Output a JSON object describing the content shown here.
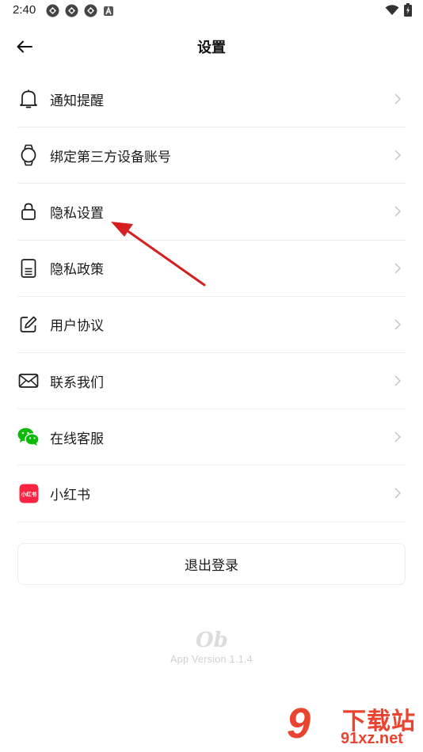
{
  "status_bar": {
    "time": "2:40",
    "notification_icons": [
      "app-icon",
      "app-icon",
      "app-icon",
      "a-icon"
    ],
    "right_icons": [
      "wifi-icon",
      "battery-icon"
    ]
  },
  "header": {
    "back_icon": "arrow-left-icon",
    "title": "设置"
  },
  "menu": {
    "items": [
      {
        "label": "通知提醒",
        "icon": "bell-icon"
      },
      {
        "label": "绑定第三方设备账号",
        "icon": "watch-icon"
      },
      {
        "label": "隐私设置",
        "icon": "lock-icon"
      },
      {
        "label": "隐私政策",
        "icon": "document-icon"
      },
      {
        "label": "用户协议",
        "icon": "edit-icon"
      },
      {
        "label": "联系我们",
        "icon": "mail-icon"
      },
      {
        "label": "在线客服",
        "icon": "wechat-icon"
      },
      {
        "label": "小红书",
        "icon": "xiaohongshu-icon"
      }
    ]
  },
  "xiaohongshu_badge": "小红书",
  "logout_label": "退出登录",
  "app": {
    "logo_text": "Ob",
    "version": "App Version 1.1.4"
  },
  "watermark": {
    "big": "9",
    "text": "下载站",
    "url": "91xz.net"
  },
  "colors": {
    "accent_red": "#e8442f",
    "wechat_green": "#09bb07",
    "xiaohongshu_red": "#ff2442",
    "annotation_arrow": "#d42020"
  }
}
